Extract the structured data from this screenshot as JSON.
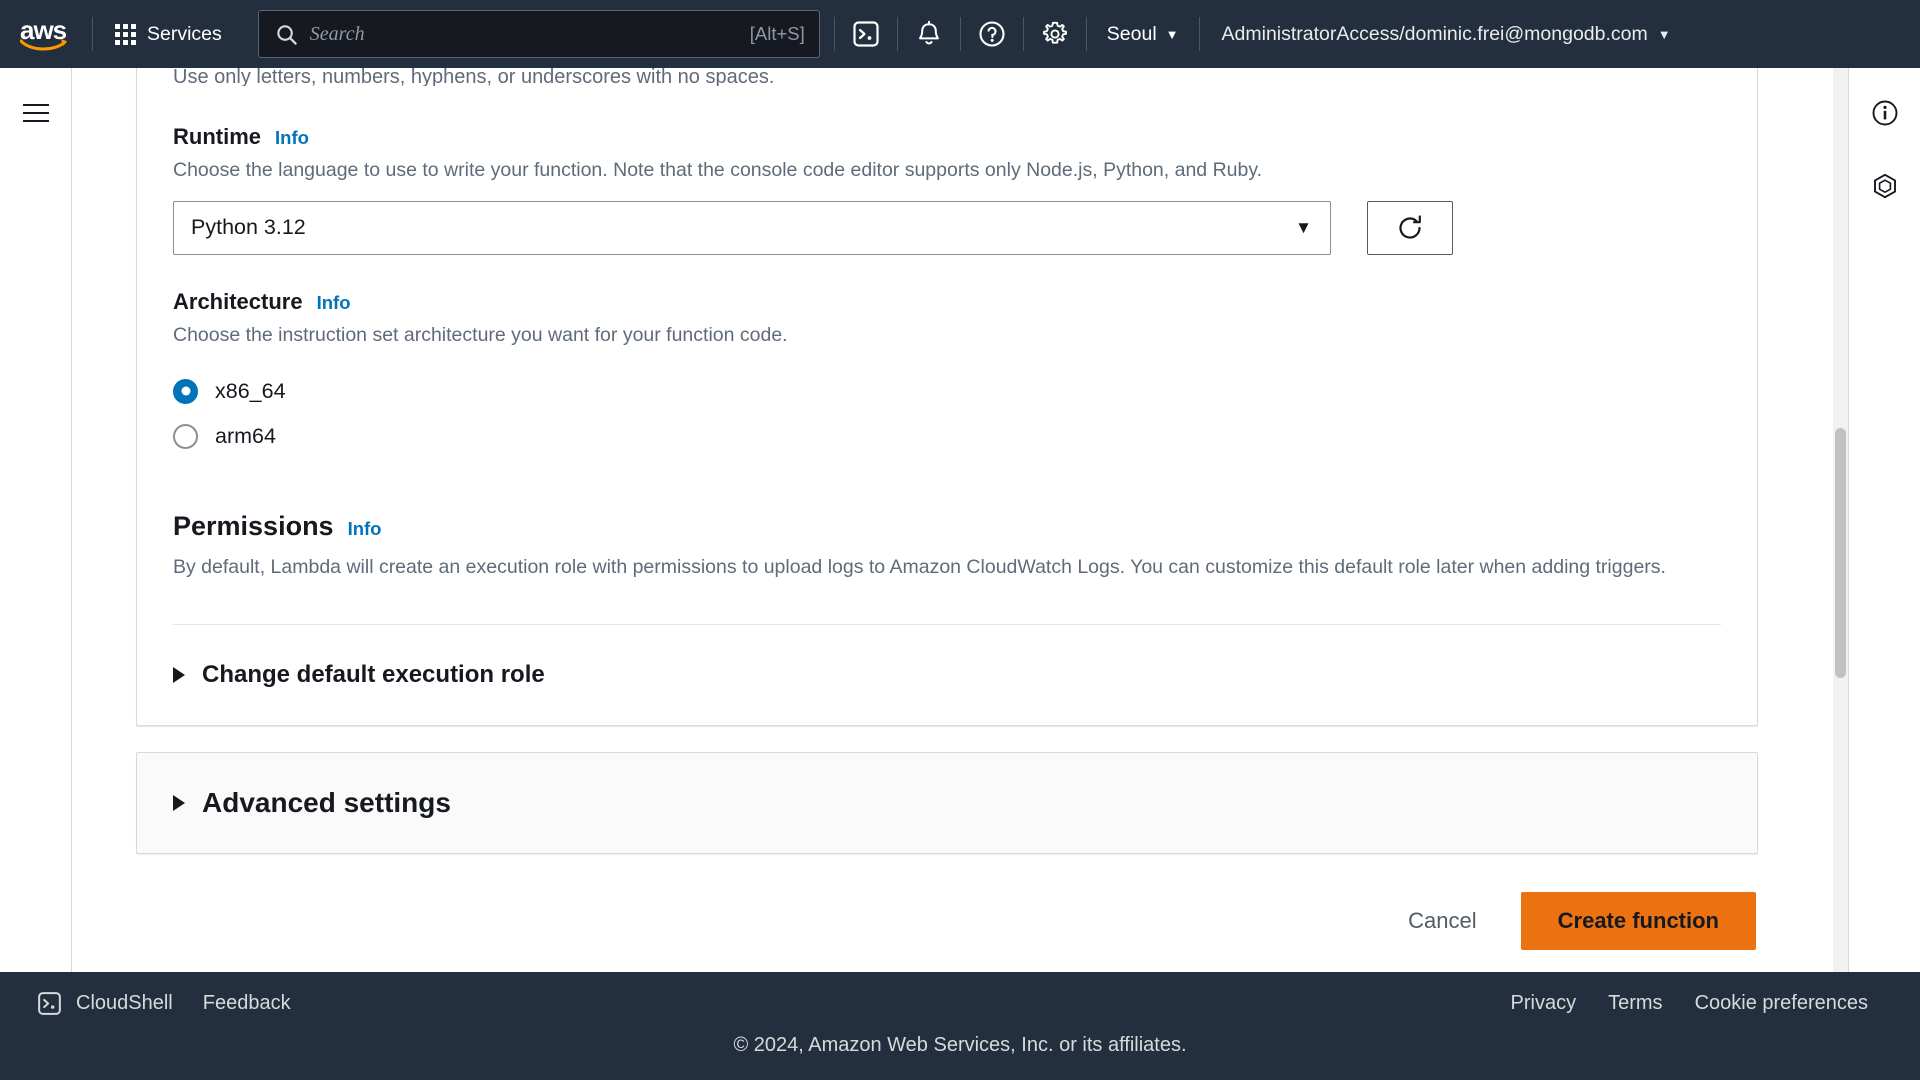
{
  "topnav": {
    "logo_alt": "aws",
    "services_label": "Services",
    "search": {
      "placeholder": "Search",
      "shortcut": "[Alt+S]",
      "icon": "search-icon"
    },
    "icons": [
      {
        "name": "cloudshell-icon",
        "glyph": ">_"
      },
      {
        "name": "notifications-bell-icon"
      },
      {
        "name": "help-question-icon"
      },
      {
        "name": "settings-gear-icon"
      }
    ],
    "region": "Seoul",
    "region_caret": "▼",
    "account": "AdministratorAccess/dominic.frei@mongodb.com",
    "account_caret": "▼"
  },
  "left_rail": {
    "menu_icon": "hamburger-menu-icon"
  },
  "right_rail": {
    "icons": [
      {
        "name": "info-circle-icon"
      },
      {
        "name": "layers-hexagon-icon"
      }
    ]
  },
  "form": {
    "clipped_hint": "Use only letters, numbers, hyphens, or underscores with no spaces.",
    "runtime": {
      "label": "Runtime",
      "info": "Info",
      "description": "Choose the language to use to write your function. Note that the console code editor supports only Node.js, Python, and Ruby.",
      "selected": "Python 3.12",
      "caret": "▼",
      "refresh_icon": "refresh-icon"
    },
    "architecture": {
      "label": "Architecture",
      "info": "Info",
      "description": "Choose the instruction set architecture you want for your function code.",
      "options": [
        {
          "label": "x86_64",
          "selected": true
        },
        {
          "label": "arm64",
          "selected": false
        }
      ]
    },
    "permissions": {
      "label": "Permissions",
      "info": "Info",
      "description": "By default, Lambda will create an execution role with permissions to upload logs to Amazon CloudWatch Logs. You can customize this default role later when adding triggers."
    },
    "change_role_expander": "Change default execution role",
    "advanced_settings_expander": "Advanced settings"
  },
  "actions": {
    "cancel": "Cancel",
    "create": "Create function"
  },
  "footer": {
    "cloudshell": "CloudShell",
    "feedback": "Feedback",
    "privacy": "Privacy",
    "terms": "Terms",
    "cookies": "Cookie preferences",
    "copyright": "© 2024, Amazon Web Services, Inc. or its affiliates."
  },
  "colors": {
    "nav_bg": "#232f3e",
    "accent_orange": "#ec7211",
    "link_blue": "#0073bb",
    "radio_blue": "#0073bb"
  }
}
